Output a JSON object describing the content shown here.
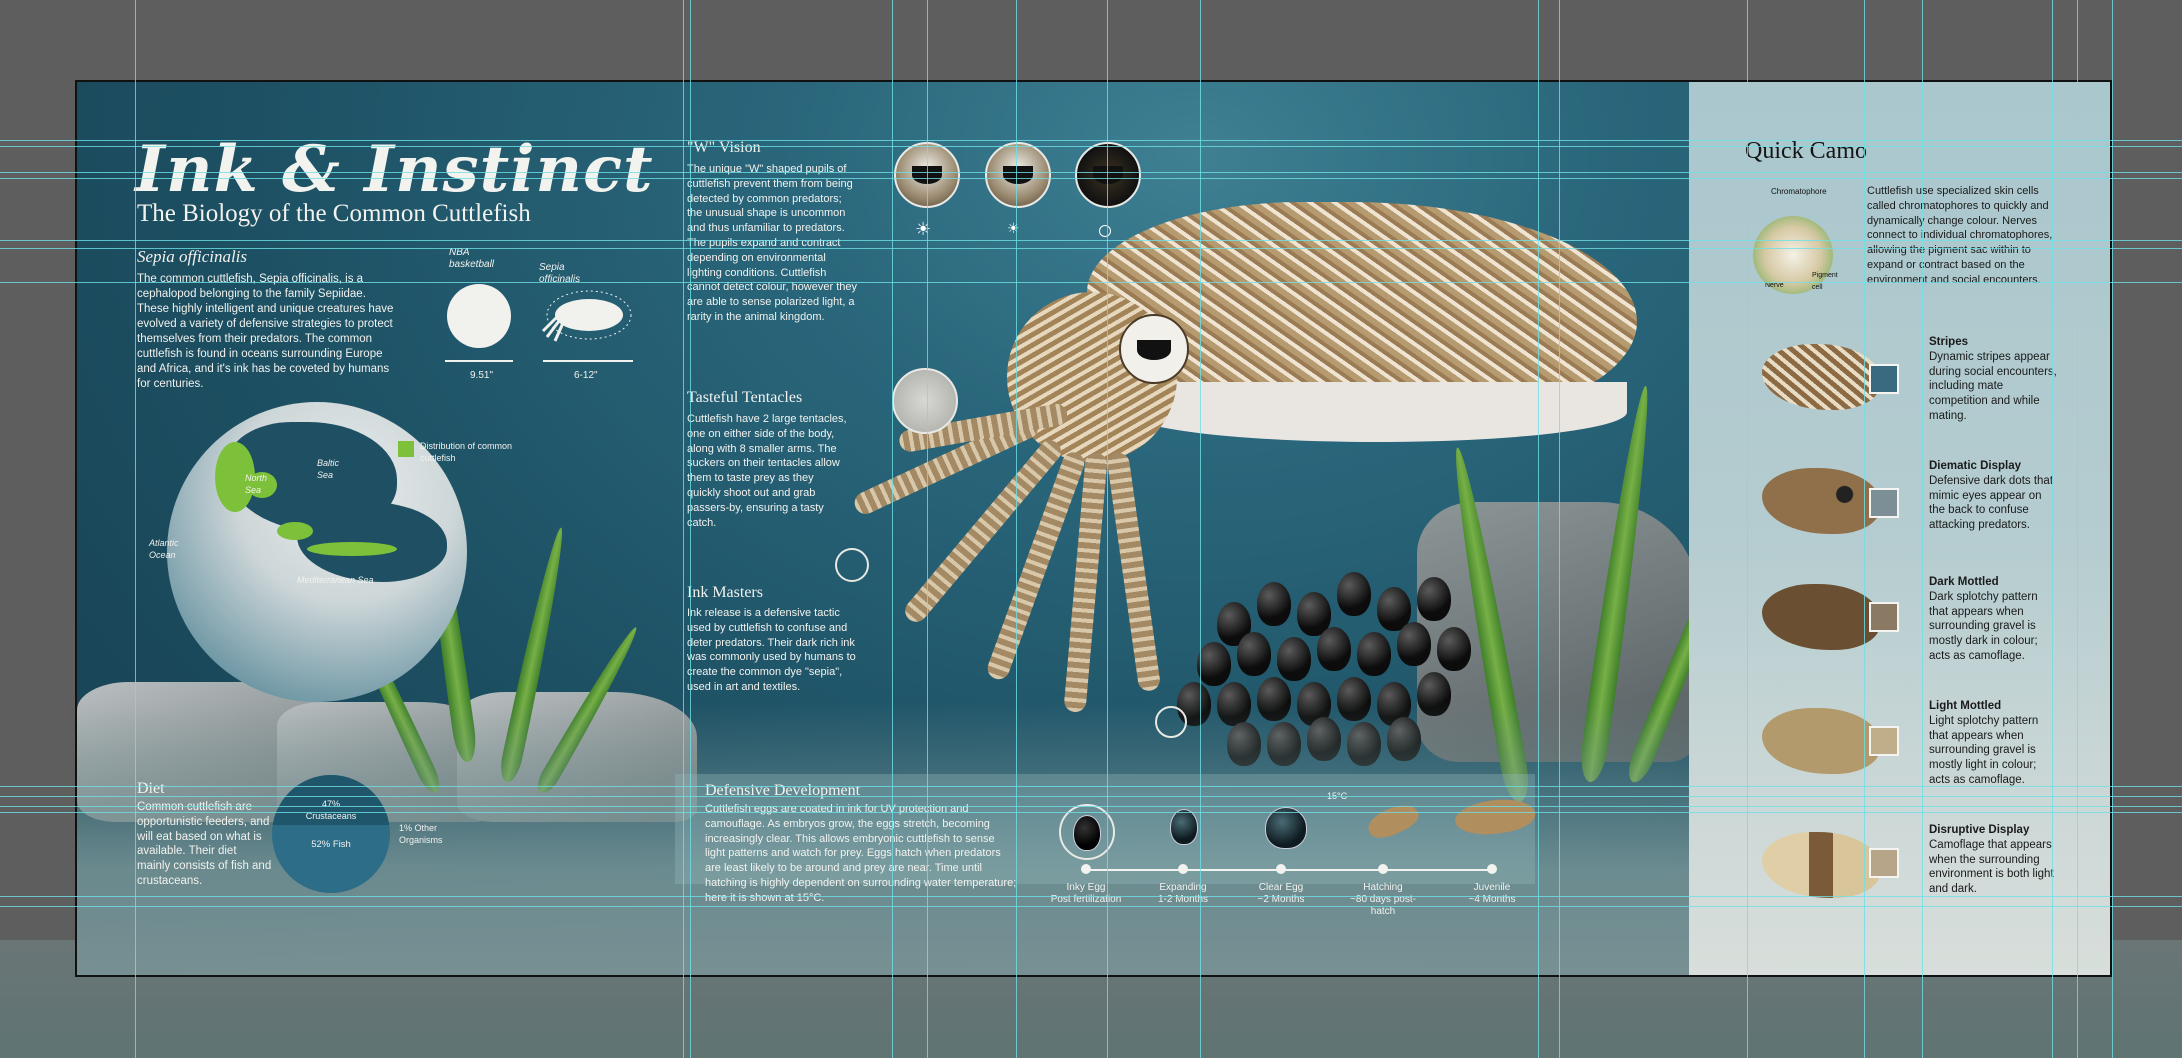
{
  "header": {
    "title": "Ink & Instinct",
    "subtitle": "The Biology of the Common Cuttlefish",
    "species": "Sepia officinalis",
    "intro": "The common cuttlefish, Sepia officinalis, is a cephalopod belonging to the family Sepiidae. These highly intelligent and unique creatures have evolved a variety of defensive strategies to protect themselves from their predators. The common cuttlefish is found in oceans surrounding Europe and Africa, and it's ink has be coveted by humans for centuries."
  },
  "size_compare": {
    "ball_label": "NBA basketball",
    "ball_size": "9.51\"",
    "cuttle_label": "Sepia officinalis",
    "cuttle_size": "6-12\""
  },
  "map": {
    "legend": "Distribution of common cuttlefish",
    "labels": {
      "north_sea": "North Sea",
      "baltic": "Baltic Sea",
      "atlantic": "Atlantic Ocean",
      "med": "Mediterranean Sea"
    }
  },
  "diet": {
    "heading": "Diet",
    "text": "Common cuttlefish are opportunistic feeders, and will eat based on what is available. Their diet mainly consists of fish and crustaceans.",
    "crustaceans": "47% Crustaceans",
    "fish": "52% Fish",
    "other": "1% Other Organisms"
  },
  "vision": {
    "heading": "\"W\" Vision",
    "text": "The unique \"W\" shaped pupils of cuttlefish prevent them from being detected by common predators; the unusual shape is uncommon and thus unfamiliar to predators. The pupils expand and contract depending on environmental lighting conditions. Cuttlefish cannot detect colour, however they are able to sense polarized light, a rarity in the animal kingdom."
  },
  "tentacles": {
    "heading": "Tasteful Tentacles",
    "text": "Cuttlefish have 2 large tentacles, one on either side of the body, along with 8 smaller arms. The suckers on their tentacles allow them to taste prey as they quickly shoot out and grab passers-by, ensuring a tasty catch."
  },
  "ink": {
    "heading": "Ink Masters",
    "text": "Ink release is a defensive tactic used by cuttlefish to confuse and deter predators. Their dark rich ink was commonly used by humans to create the common dye \"sepia\", used in art and textiles."
  },
  "development": {
    "heading": "Defensive Development",
    "text": "Cuttlefish eggs are coated in ink for UV protection and camouflage. As embryos grow, the eggs stretch, becoming increasingly clear. This allows embryonic cuttlefish to sense light patterns and watch for prey. Eggs hatch when predators are least likely to be around and prey are near. Time until hatching is highly dependent on surrounding water temperature; here it is shown at 15°C.",
    "temp": "15°C",
    "stages": [
      {
        "name": "Inky Egg",
        "time": "Post fertilization"
      },
      {
        "name": "Expanding",
        "time": "1-2 Months"
      },
      {
        "name": "Clear Egg",
        "time": "~2 Months"
      },
      {
        "name": "Hatching",
        "time": "~80 days post-hatch"
      },
      {
        "name": "Juvenile",
        "time": "~4 Months"
      }
    ]
  },
  "camo": {
    "title": "Quick Camo",
    "chromatophore_label": "Chromatophore",
    "pigment_label": "Pigment cell",
    "nerve_label": "Nerve",
    "intro": "Cuttlefish use specialized skin cells called chromatophores to quickly and dynamically change colour. Nerves connect to individual chromatophores, allowing the pigment sac within to expand or contract based on the environment and social encounters.",
    "items": [
      {
        "name": "Stripes",
        "text": "Dynamic stripes appear during social encounters, including mate competition and while mating."
      },
      {
        "name": "Diematic Display",
        "text": "Defensive dark dots that mimic eyes appear on the back to confuse attacking predators."
      },
      {
        "name": "Dark Mottled",
        "text": "Dark splotchy pattern that appears when surrounding gravel is mostly dark in colour; acts as camoflage."
      },
      {
        "name": "Light Mottled",
        "text": "Light splotchy pattern that appears when surrounding gravel is mostly light in colour; acts as camoflage."
      },
      {
        "name": "Disruptive Display",
        "text": "Camoflage that appears when the surrounding environment is both light and dark."
      }
    ]
  },
  "colors": {
    "ocean": "#1f5266",
    "panel": "#b3cbcf",
    "accent_green": "#7dc13a",
    "guide": "#6ee0e6"
  }
}
